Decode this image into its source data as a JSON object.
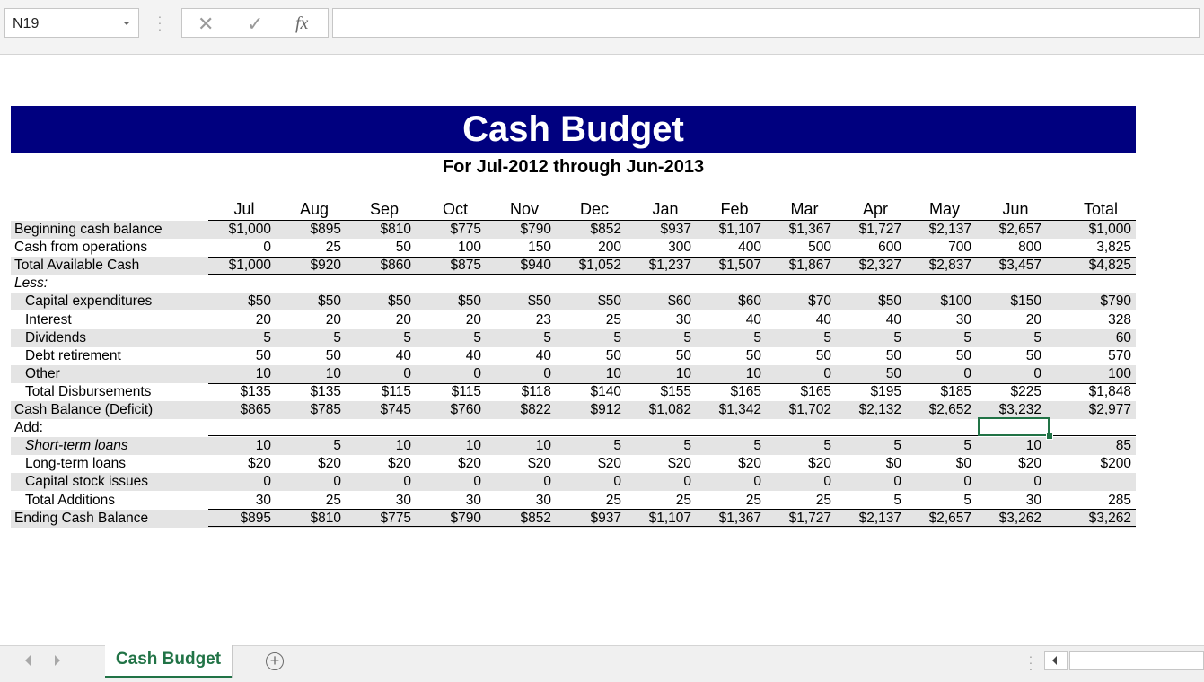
{
  "formula_bar": {
    "name_box": "N19",
    "cancel_icon": "✕",
    "enter_icon": "✓",
    "fx_label": "fx",
    "formula": ""
  },
  "sheet": {
    "title": "Cash Budget",
    "subtitle": "For Jul-2012 through Jun-2013",
    "colors": {
      "title_bg": "#00007f",
      "shade": "#e4e4e4",
      "accent": "#217346"
    },
    "columns": [
      "Jul",
      "Aug",
      "Sep",
      "Oct",
      "Nov",
      "Dec",
      "Jan",
      "Feb",
      "Mar",
      "Apr",
      "May",
      "Jun",
      "Total"
    ],
    "rows": [
      {
        "label": "Beginning cash balance",
        "values": [
          "$1,000",
          "$895",
          "$810",
          "$775",
          "$790",
          "$852",
          "$937",
          "$1,107",
          "$1,367",
          "$1,727",
          "$2,137",
          "$2,657",
          "$1,000"
        ]
      },
      {
        "label": "Cash from operations",
        "values": [
          "0",
          "25",
          "50",
          "100",
          "150",
          "200",
          "300",
          "400",
          "500",
          "600",
          "700",
          "800",
          "3,825"
        ]
      },
      {
        "label": "Total Available Cash",
        "values": [
          "$1,000",
          "$920",
          "$860",
          "$875",
          "$940",
          "$1,052",
          "$1,237",
          "$1,507",
          "$1,867",
          "$2,327",
          "$2,837",
          "$3,457",
          "$4,825"
        ]
      },
      {
        "label": "Less:",
        "values": []
      },
      {
        "label": "Capital expenditures",
        "values": [
          "$50",
          "$50",
          "$50",
          "$50",
          "$50",
          "$50",
          "$60",
          "$60",
          "$70",
          "$50",
          "$100",
          "$150",
          "$790"
        ]
      },
      {
        "label": "Interest",
        "values": [
          "20",
          "20",
          "20",
          "20",
          "23",
          "25",
          "30",
          "40",
          "40",
          "40",
          "30",
          "20",
          "328"
        ]
      },
      {
        "label": "Dividends",
        "values": [
          "5",
          "5",
          "5",
          "5",
          "5",
          "5",
          "5",
          "5",
          "5",
          "5",
          "5",
          "5",
          "60"
        ]
      },
      {
        "label": "Debt retirement",
        "values": [
          "50",
          "50",
          "40",
          "40",
          "40",
          "50",
          "50",
          "50",
          "50",
          "50",
          "50",
          "50",
          "570"
        ]
      },
      {
        "label": "Other",
        "values": [
          "10",
          "10",
          "0",
          "0",
          "0",
          "10",
          "10",
          "10",
          "0",
          "50",
          "0",
          "0",
          "100"
        ]
      },
      {
        "label": "Total Disbursements",
        "values": [
          "$135",
          "$135",
          "$115",
          "$115",
          "$118",
          "$140",
          "$155",
          "$165",
          "$165",
          "$195",
          "$185",
          "$225",
          "$1,848"
        ]
      },
      {
        "label": "Cash Balance (Deficit)",
        "values": [
          "$865",
          "$785",
          "$745",
          "$760",
          "$822",
          "$912",
          "$1,082",
          "$1,342",
          "$1,702",
          "$2,132",
          "$2,652",
          "$3,232",
          "$2,977"
        ]
      },
      {
        "label": "Add:",
        "values": []
      },
      {
        "label": "Short-term loans",
        "values": [
          "10",
          "5",
          "10",
          "10",
          "10",
          "5",
          "5",
          "5",
          "5",
          "5",
          "5",
          "10",
          "85"
        ]
      },
      {
        "label": "Long-term loans",
        "values": [
          "$20",
          "$20",
          "$20",
          "$20",
          "$20",
          "$20",
          "$20",
          "$20",
          "$20",
          "$0",
          "$0",
          "$20",
          "$200"
        ]
      },
      {
        "label": "Capital stock issues",
        "values": [
          "0",
          "0",
          "0",
          "0",
          "0",
          "0",
          "0",
          "0",
          "0",
          "0",
          "0",
          "0",
          ""
        ]
      },
      {
        "label": "Total Additions",
        "values": [
          "30",
          "25",
          "30",
          "30",
          "30",
          "25",
          "25",
          "25",
          "25",
          "5",
          "5",
          "30",
          "285"
        ]
      },
      {
        "label": "Ending Cash Balance",
        "values": [
          "$895",
          "$810",
          "$775",
          "$790",
          "$852",
          "$937",
          "$1,107",
          "$1,367",
          "$1,727",
          "$2,137",
          "$2,657",
          "$3,262",
          "$3,262"
        ]
      }
    ]
  },
  "tabs": {
    "active_tab": "Cash Budget",
    "add_icon": "+"
  }
}
